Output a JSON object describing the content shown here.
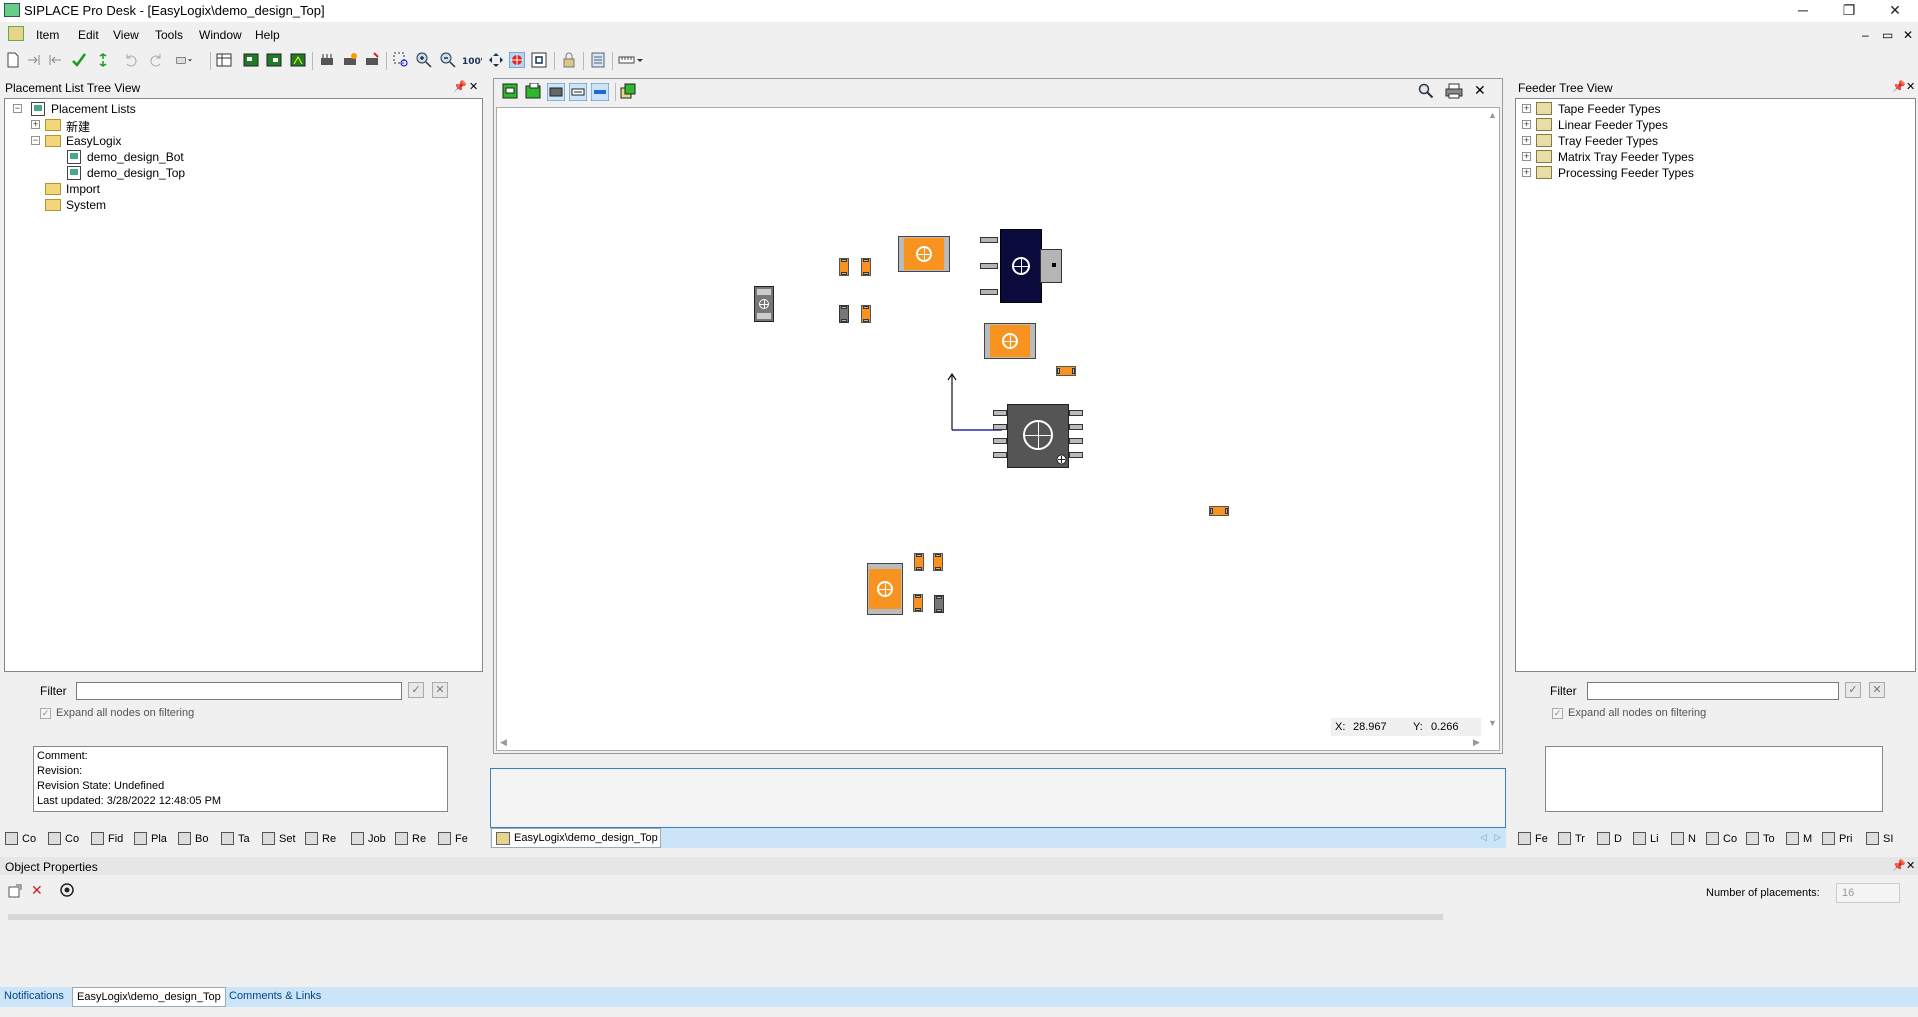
{
  "window": {
    "title": "SIPLACE Pro Desk - [EasyLogix\\demo_design_Top]",
    "minimize": "─",
    "restore": "❐",
    "close": "✕"
  },
  "menu": [
    "Item",
    "Edit",
    "View",
    "Tools",
    "Window",
    "Help"
  ],
  "mdi_controls": {
    "minimize": "–",
    "restore": "▭",
    "close": "✕"
  },
  "left_panel": {
    "title": "Placement List Tree View",
    "tree": {
      "root": "Placement Lists",
      "items": [
        {
          "label": "新建",
          "level": 1,
          "type": "folder",
          "expander": "+"
        },
        {
          "label": "EasyLogix",
          "level": 1,
          "type": "folder",
          "expander": "−"
        },
        {
          "label": "demo_design_Bot",
          "level": 2,
          "type": "doc"
        },
        {
          "label": "demo_design_Top",
          "level": 2,
          "type": "doc"
        },
        {
          "label": "Import",
          "level": 1,
          "type": "folder"
        },
        {
          "label": "System",
          "level": 1,
          "type": "folder"
        }
      ]
    },
    "filter_label": "Filter",
    "filter_value": "",
    "expand_label": "Expand all nodes on filtering",
    "info": {
      "comment": "Comment:",
      "revision": "Revision:",
      "revision_state": "Revision State: Undefined",
      "last_updated": "Last updated: 3/28/2022 12:48:05 PM"
    },
    "tabs": [
      "Co",
      "Co",
      "Fid",
      "Pla",
      "Bo",
      "Ta",
      "Set",
      "Re",
      "Job",
      "Re",
      "Fe"
    ]
  },
  "center": {
    "coord_x_label": "X:",
    "coord_x": "28.967",
    "coord_y_label": "Y:",
    "coord_y": "0.266",
    "doc_tab": "EasyLogix\\demo_design_Top"
  },
  "right_panel": {
    "title": "Feeder Tree View",
    "tree": [
      "Tape Feeder Types",
      "Linear Feeder Types",
      "Tray Feeder Types",
      "Matrix Tray Feeder Types",
      "Processing Feeder Types"
    ],
    "filter_label": "Filter",
    "filter_value": "",
    "expand_label": "Expand all nodes on filtering",
    "tabs": [
      "Fe",
      "Tr",
      "D",
      "Li",
      "N",
      "Co",
      "To",
      "M",
      "Pri",
      "SI"
    ]
  },
  "object_properties": {
    "title": "Object Properties",
    "num_placements_label": "Number of placements:",
    "num_placements": "16"
  },
  "bottom_tabs": [
    "Notifications",
    "EasyLogix\\demo_design_Top",
    "Comments & Links"
  ],
  "colors": {
    "accent_tab": "#cce4f7",
    "component_orange": "#f7931e",
    "ic_navy": "#0a0a3c",
    "ic_gray": "#555555"
  }
}
